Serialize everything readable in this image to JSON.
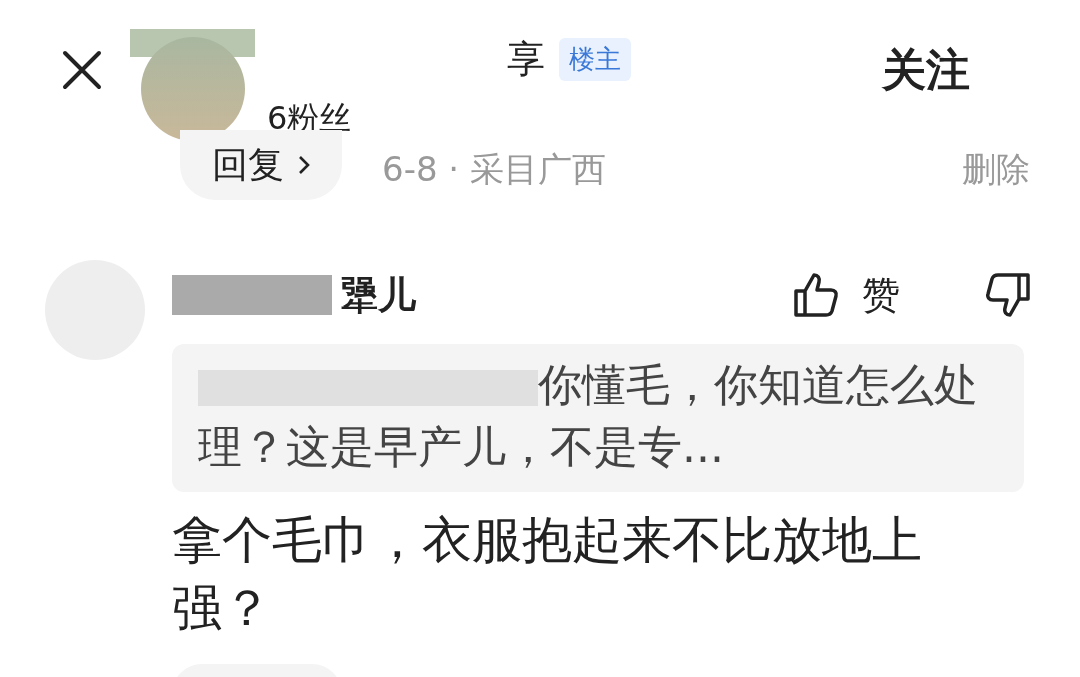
{
  "header": {
    "author_name": "享",
    "badge": "楼主",
    "followers": "6粉丝",
    "follow_button": "关注"
  },
  "previous_comment": {
    "reply_button": "回复",
    "meta": "6-8 · 采目广西",
    "delete_button": "删除"
  },
  "comment": {
    "author_name": "犟儿",
    "like_label": "赞",
    "quote": "你懂毛，你知道怎么处理？这是早产儿，不是专...",
    "body": "拿个毛巾，衣服抱起来不比放地上强？"
  }
}
